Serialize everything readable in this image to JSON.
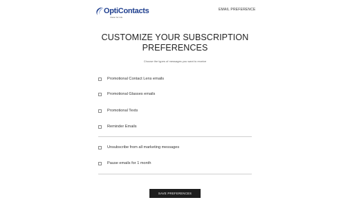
{
  "header": {
    "logo_text": "OptiContacts",
    "logo_tagline": "Vision for Life",
    "nav_link": "EMAIL PREFERENCE",
    "brand_color": "#1f3f8f"
  },
  "main": {
    "title_line1": "CUSTOMIZE YOUR SUBSCRIPTION",
    "title_line2": "PREFERENCES",
    "subtitle": "Choose the types of messages you want to receive"
  },
  "options": {
    "group1": [
      {
        "label": "Promotional Contact Lens emails"
      },
      {
        "label": "Promotional Glasses emails"
      },
      {
        "label": "Promotional Texts"
      },
      {
        "label": "Reminder Emails"
      }
    ],
    "group2": [
      {
        "label": "Unsubscribe from all marketing messages"
      },
      {
        "label": "Pause emails for 1 month"
      }
    ]
  },
  "actions": {
    "save_label": "SAVE PREFERENCES",
    "button_color": "#1e1e1e"
  }
}
